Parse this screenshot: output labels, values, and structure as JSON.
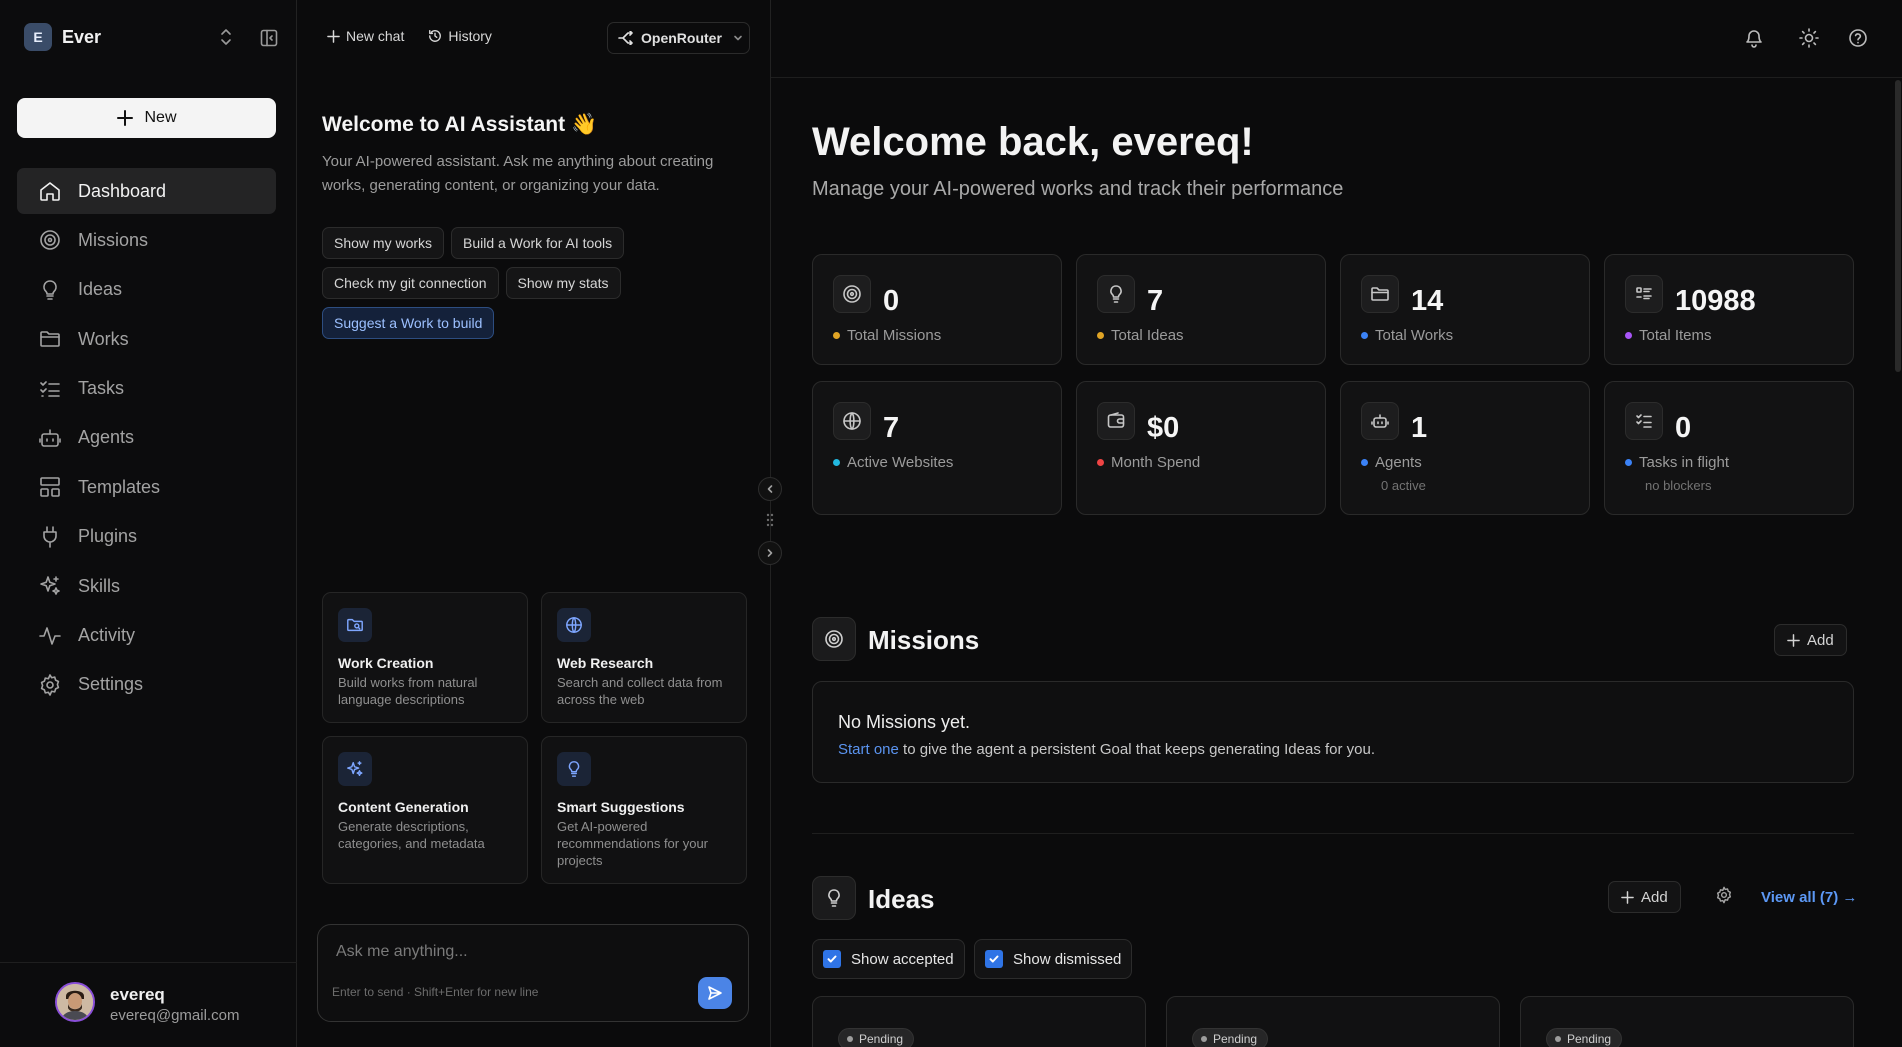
{
  "workspace": {
    "initial": "E",
    "name": "Ever"
  },
  "sidebar": {
    "new_label": "New",
    "items": [
      {
        "label": "Dashboard",
        "icon": "home-icon",
        "active": true
      },
      {
        "label": "Missions",
        "icon": "target-icon"
      },
      {
        "label": "Ideas",
        "icon": "lightbulb-icon"
      },
      {
        "label": "Works",
        "icon": "folder-icon"
      },
      {
        "label": "Tasks",
        "icon": "list-checks-icon"
      },
      {
        "label": "Agents",
        "icon": "bot-icon"
      },
      {
        "label": "Templates",
        "icon": "layout-icon"
      },
      {
        "label": "Plugins",
        "icon": "plug-icon"
      },
      {
        "label": "Skills",
        "icon": "sparkles-icon"
      },
      {
        "label": "Activity",
        "icon": "activity-icon"
      },
      {
        "label": "Settings",
        "icon": "gear-icon"
      }
    ]
  },
  "user": {
    "name": "evereq",
    "email": "evereq@gmail.com"
  },
  "chat": {
    "new_chat": "New chat",
    "history": "History",
    "provider": "OpenRouter",
    "title": "Welcome to AI Assistant 👋",
    "subtitle": "Your AI-powered assistant. Ask me anything about creating works, generating content, or organizing your data.",
    "chips": [
      [
        "Show my works",
        "Build a Work for AI tools"
      ],
      [
        "Check my git connection",
        "Show my stats"
      ],
      [
        "Suggest a Work to build"
      ]
    ],
    "features": [
      {
        "title": "Work Creation",
        "desc": "Build works from natural language descriptions",
        "icon": "folder-search-icon"
      },
      {
        "title": "Web Research",
        "desc": "Search and collect data from across the web",
        "icon": "globe-icon"
      },
      {
        "title": "Content Generation",
        "desc": "Generate descriptions, categories, and metadata",
        "icon": "sparkles-icon"
      },
      {
        "title": "Smart Suggestions",
        "desc": "Get AI-powered recommendations for your projects",
        "icon": "lightbulb-icon"
      }
    ],
    "input_placeholder": "Ask me anything...",
    "input_hint": "Enter to send · Shift+Enter for new line"
  },
  "main": {
    "title": "Welcome back, evereq!",
    "subtitle": "Manage your AI-powered works and track their performance",
    "stats": [
      {
        "value": "0",
        "label": "Total Missions",
        "dot": "#e0a425",
        "icon": "target-icon"
      },
      {
        "value": "7",
        "label": "Total Ideas",
        "dot": "#e0a425",
        "icon": "lightbulb-icon"
      },
      {
        "value": "14",
        "label": "Total Works",
        "dot": "#3b82f6",
        "icon": "folder-icon"
      },
      {
        "value": "10988",
        "label": "Total Items",
        "dot": "#a855f7",
        "icon": "list-icon"
      },
      {
        "value": "7",
        "label": "Active Websites",
        "dot": "#22b8e0",
        "icon": "globe-icon"
      },
      {
        "value": "$0",
        "label": "Month Spend",
        "dot": "#ef4444",
        "icon": "wallet-icon"
      },
      {
        "value": "1",
        "label": "Agents",
        "sub": "0 active",
        "dot": "#3b82f6",
        "icon": "bot-icon"
      },
      {
        "value": "0",
        "label": "Tasks in flight",
        "sub": "no blockers",
        "dot": "#3b82f6",
        "icon": "list-checks-icon"
      }
    ],
    "missions": {
      "title": "Missions",
      "add": "Add",
      "empty_title": "No Missions yet.",
      "empty_link": "Start one",
      "empty_rest": " to give the agent a persistent Goal that keeps generating Ideas for you."
    },
    "ideas": {
      "title": "Ideas",
      "add": "Add",
      "view_all": "View all (7) →",
      "show_accepted": "Show accepted",
      "show_dismissed": "Show dismissed",
      "cards": [
        {
          "status": "Pending"
        },
        {
          "status": "Pending"
        },
        {
          "status": "Pending"
        }
      ]
    }
  }
}
